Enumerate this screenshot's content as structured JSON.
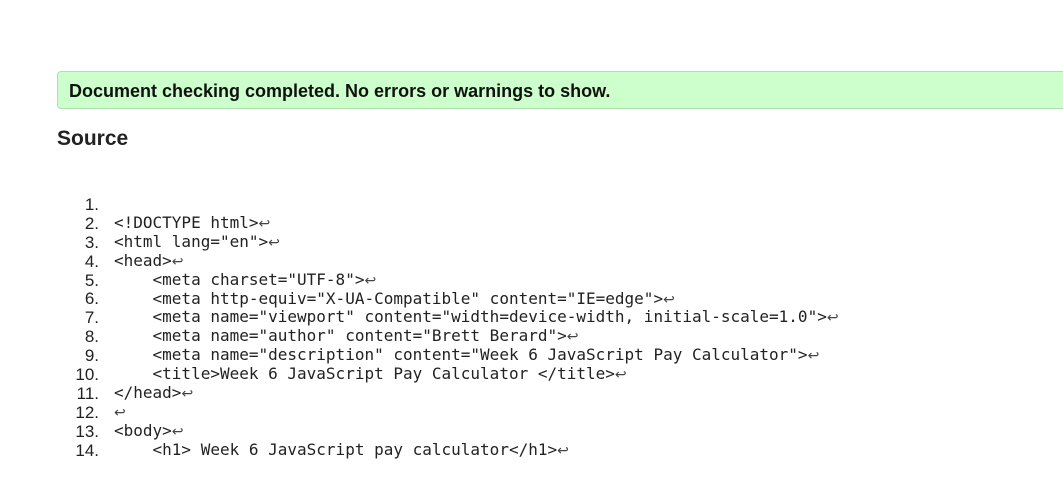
{
  "banner": {
    "message": "Document checking completed. No errors or warnings to show."
  },
  "source": {
    "heading": "Source",
    "return_glyph": "↩",
    "lines": [
      {
        "number": "1.",
        "code": "<!DOCTYPE html>"
      },
      {
        "number": "2.",
        "code": "<html lang=\"en\">"
      },
      {
        "number": "3.",
        "code": "<head>"
      },
      {
        "number": "4.",
        "code": "    <meta charset=\"UTF-8\">"
      },
      {
        "number": "5.",
        "code": "    <meta http-equiv=\"X-UA-Compatible\" content=\"IE=edge\">"
      },
      {
        "number": "6.",
        "code": "    <meta name=\"viewport\" content=\"width=device-width, initial-scale=1.0\">"
      },
      {
        "number": "7.",
        "code": "    <meta name=\"author\" content=\"Brett Berard\">"
      },
      {
        "number": "8.",
        "code": "    <meta name=\"description\" content=\"Week 6 JavaScript Pay Calculator\">"
      },
      {
        "number": "9.",
        "code": "    <title>Week 6 JavaScript Pay Calculator </title>"
      },
      {
        "number": "10.",
        "code": "</head>"
      },
      {
        "number": "11.",
        "code": ""
      },
      {
        "number": "12.",
        "code": "<body>"
      },
      {
        "number": "13.",
        "code": "    <h1> Week 6 JavaScript pay calculator</h1>"
      },
      {
        "number": "14.",
        "code": "    "
      }
    ]
  },
  "colors": {
    "banner_background": "#ccffcc",
    "banner_border": "#b4dcb4"
  }
}
